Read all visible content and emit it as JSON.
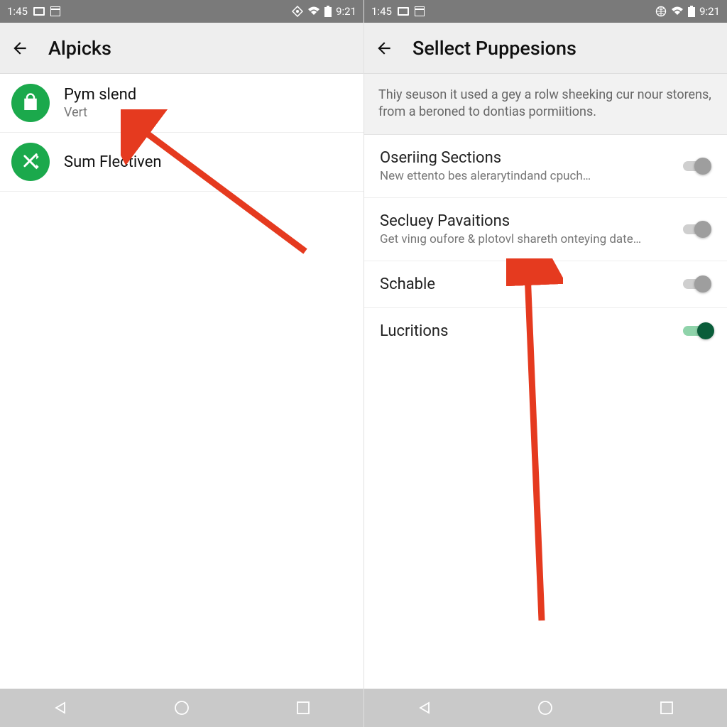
{
  "status": {
    "time": "9:21",
    "time_left": "1:45"
  },
  "left": {
    "app_title": "Alpicks",
    "items": [
      {
        "title": "Pym slend",
        "sub": "Vert",
        "icon": "bag-icon"
      },
      {
        "title": "Sum Flectiven",
        "sub": "",
        "icon": "cross-arrows-icon"
      }
    ]
  },
  "right": {
    "app_title": "Sellect Puppesions",
    "description": "Thiy seuson it used a gey a rolw sheeking cur nour storens, from a beroned to dontias pormiitions.",
    "rows": [
      {
        "title": "Oseriing Sections",
        "sub": "New ettento bes alerarytindand cpuch…",
        "on": false
      },
      {
        "title": "Secluey Pavaitions",
        "sub": "Get vinıg oufore & plotovl shareth onteying date…",
        "on": false
      },
      {
        "title": "Schable",
        "sub": "",
        "on": false
      },
      {
        "title": "Lucritions",
        "sub": "",
        "on": true
      }
    ]
  },
  "colors": {
    "green": "#1ba94c",
    "dark_green": "#0a5d3a",
    "arrow": "#e53a1f"
  }
}
